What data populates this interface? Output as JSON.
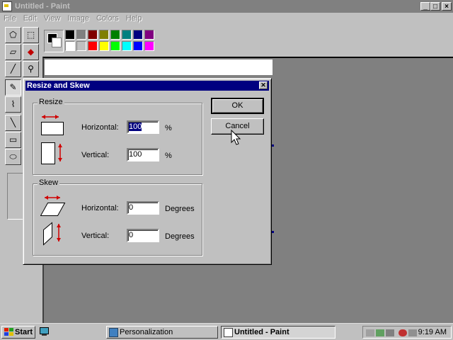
{
  "window": {
    "title": "Untitled - Paint"
  },
  "menu": [
    "File",
    "Edit",
    "View",
    "Image",
    "Colors",
    "Help"
  ],
  "palette": {
    "foreground": "#000000",
    "background": "#ffffff",
    "colors_top": [
      "#000000",
      "#808080",
      "#800000",
      "#808000",
      "#008000",
      "#008080",
      "#000080",
      "#800080"
    ],
    "colors_bottom": [
      "#ffffff",
      "#c0c0c0",
      "#ff0000",
      "#ffff00",
      "#00ff00",
      "#00ffff",
      "#0000ff",
      "#ff00ff"
    ]
  },
  "tools": [
    "free-select-icon",
    "rect-select-icon",
    "eraser-icon",
    "fill-icon",
    "eyedropper-icon",
    "magnifier-icon",
    "pencil-icon",
    "brush-icon",
    "line-icon",
    "curve-icon",
    "rectangle-icon",
    "polygon-icon",
    "ellipse-icon"
  ],
  "dialog": {
    "title": "Resize and Skew",
    "ok_label": "OK",
    "cancel_label": "Cancel",
    "resize": {
      "label": "Resize",
      "horizontal_label": "Horizontal:",
      "horizontal_value": "100",
      "vertical_label": "Vertical:",
      "vertical_value": "100",
      "unit": "%"
    },
    "skew": {
      "label": "Skew",
      "horizontal_label": "Horizontal:",
      "horizontal_value": "0",
      "vertical_label": "Vertical:",
      "vertical_value": "0",
      "unit": "Degrees"
    }
  },
  "taskbar": {
    "start_label": "Start",
    "tasks": [
      {
        "label": "Personalization"
      },
      {
        "label": "Untitled - Paint"
      }
    ],
    "clock": "9:19 AM"
  }
}
